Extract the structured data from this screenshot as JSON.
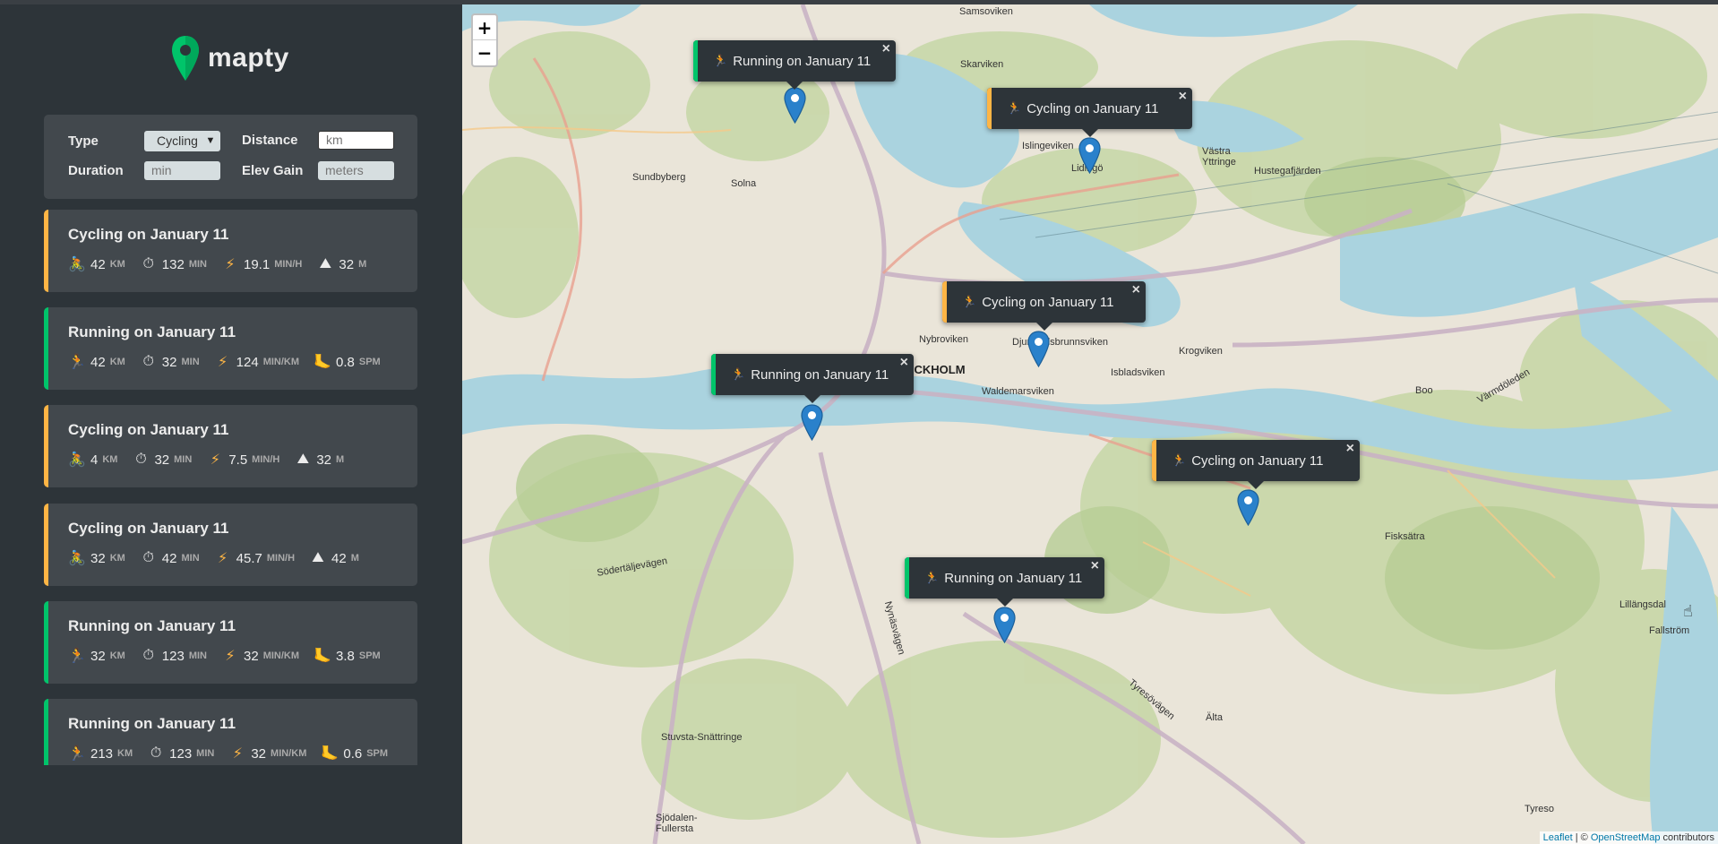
{
  "app": {
    "name": "mapty"
  },
  "form": {
    "type_label": "Type",
    "type_value": "Cycling",
    "distance_label": "Distance",
    "distance_placeholder": "km",
    "duration_label": "Duration",
    "duration_placeholder": "min",
    "elev_label": "Elev Gain",
    "elev_placeholder": "meters"
  },
  "colors": {
    "running": "#00c46a",
    "cycling": "#ffb545",
    "panel": "#42484d",
    "sidebar": "#2d3439"
  },
  "workouts": [
    {
      "type": "cycling",
      "title": "Cycling on January 11",
      "distance": "42",
      "duration": "132",
      "speed": "19.1",
      "speed_unit": "MIN/H",
      "extra": "32",
      "extra_unit": "M"
    },
    {
      "type": "running",
      "title": "Running on January 11",
      "distance": "42",
      "duration": "32",
      "speed": "124",
      "speed_unit": "MIN/KM",
      "extra": "0.8",
      "extra_unit": "SPM"
    },
    {
      "type": "cycling",
      "title": "Cycling on January 11",
      "distance": "4",
      "duration": "32",
      "speed": "7.5",
      "speed_unit": "MIN/H",
      "extra": "32",
      "extra_unit": "M"
    },
    {
      "type": "cycling",
      "title": "Cycling on January 11",
      "distance": "32",
      "duration": "42",
      "speed": "45.7",
      "speed_unit": "MIN/H",
      "extra": "42",
      "extra_unit": "M"
    },
    {
      "type": "running",
      "title": "Running on January 11",
      "distance": "32",
      "duration": "123",
      "speed": "32",
      "speed_unit": "MIN/KM",
      "extra": "3.8",
      "extra_unit": "SPM"
    },
    {
      "type": "running",
      "title": "Running on January 11",
      "distance": "213",
      "duration": "123",
      "speed": "32",
      "speed_unit": "MIN/KM",
      "extra": "0.6",
      "extra_unit": "SPM"
    }
  ],
  "units": {
    "km": "KM",
    "min": "MIN"
  },
  "map": {
    "zoom_in": "+",
    "zoom_out": "−",
    "popups": [
      {
        "type": "running",
        "text": "Running on January 11"
      },
      {
        "type": "cycling",
        "text": "Cycling on January 11"
      },
      {
        "type": "cycling",
        "text": "Cycling on January 11"
      },
      {
        "type": "running",
        "text": "Running on January 11"
      },
      {
        "type": "cycling",
        "text": "Cycling on January 11"
      },
      {
        "type": "running",
        "text": "Running on January 11"
      }
    ],
    "close_glyph": "×",
    "place_labels": [
      "Samsoviken",
      "Skarviken",
      "Sundbyberg",
      "Solna",
      "Islingeviken",
      "Lidingö",
      "Hustegafjärden",
      "Nybroviken",
      "Djurgårdsbrunnsviken",
      "STOCKHOLM",
      "Waldemarsviken",
      "Isbladsviken",
      "Krogviken",
      "Boo",
      "Värmdöleden",
      "Fisksätra",
      "Södertäljevägen",
      "Nynäsvägen",
      "Tyresövägen",
      "Älta",
      "Stuvsta-Snättringe",
      "Sjödalen-Fullersta",
      "Tyreso",
      "Fallström",
      "Lillängsdal",
      "Västra Yttringe"
    ],
    "attribution_leaflet": "Leaflet",
    "attribution_sep": " | © ",
    "attribution_osm": "OpenStreetMap",
    "attribution_rest": " contributors"
  }
}
